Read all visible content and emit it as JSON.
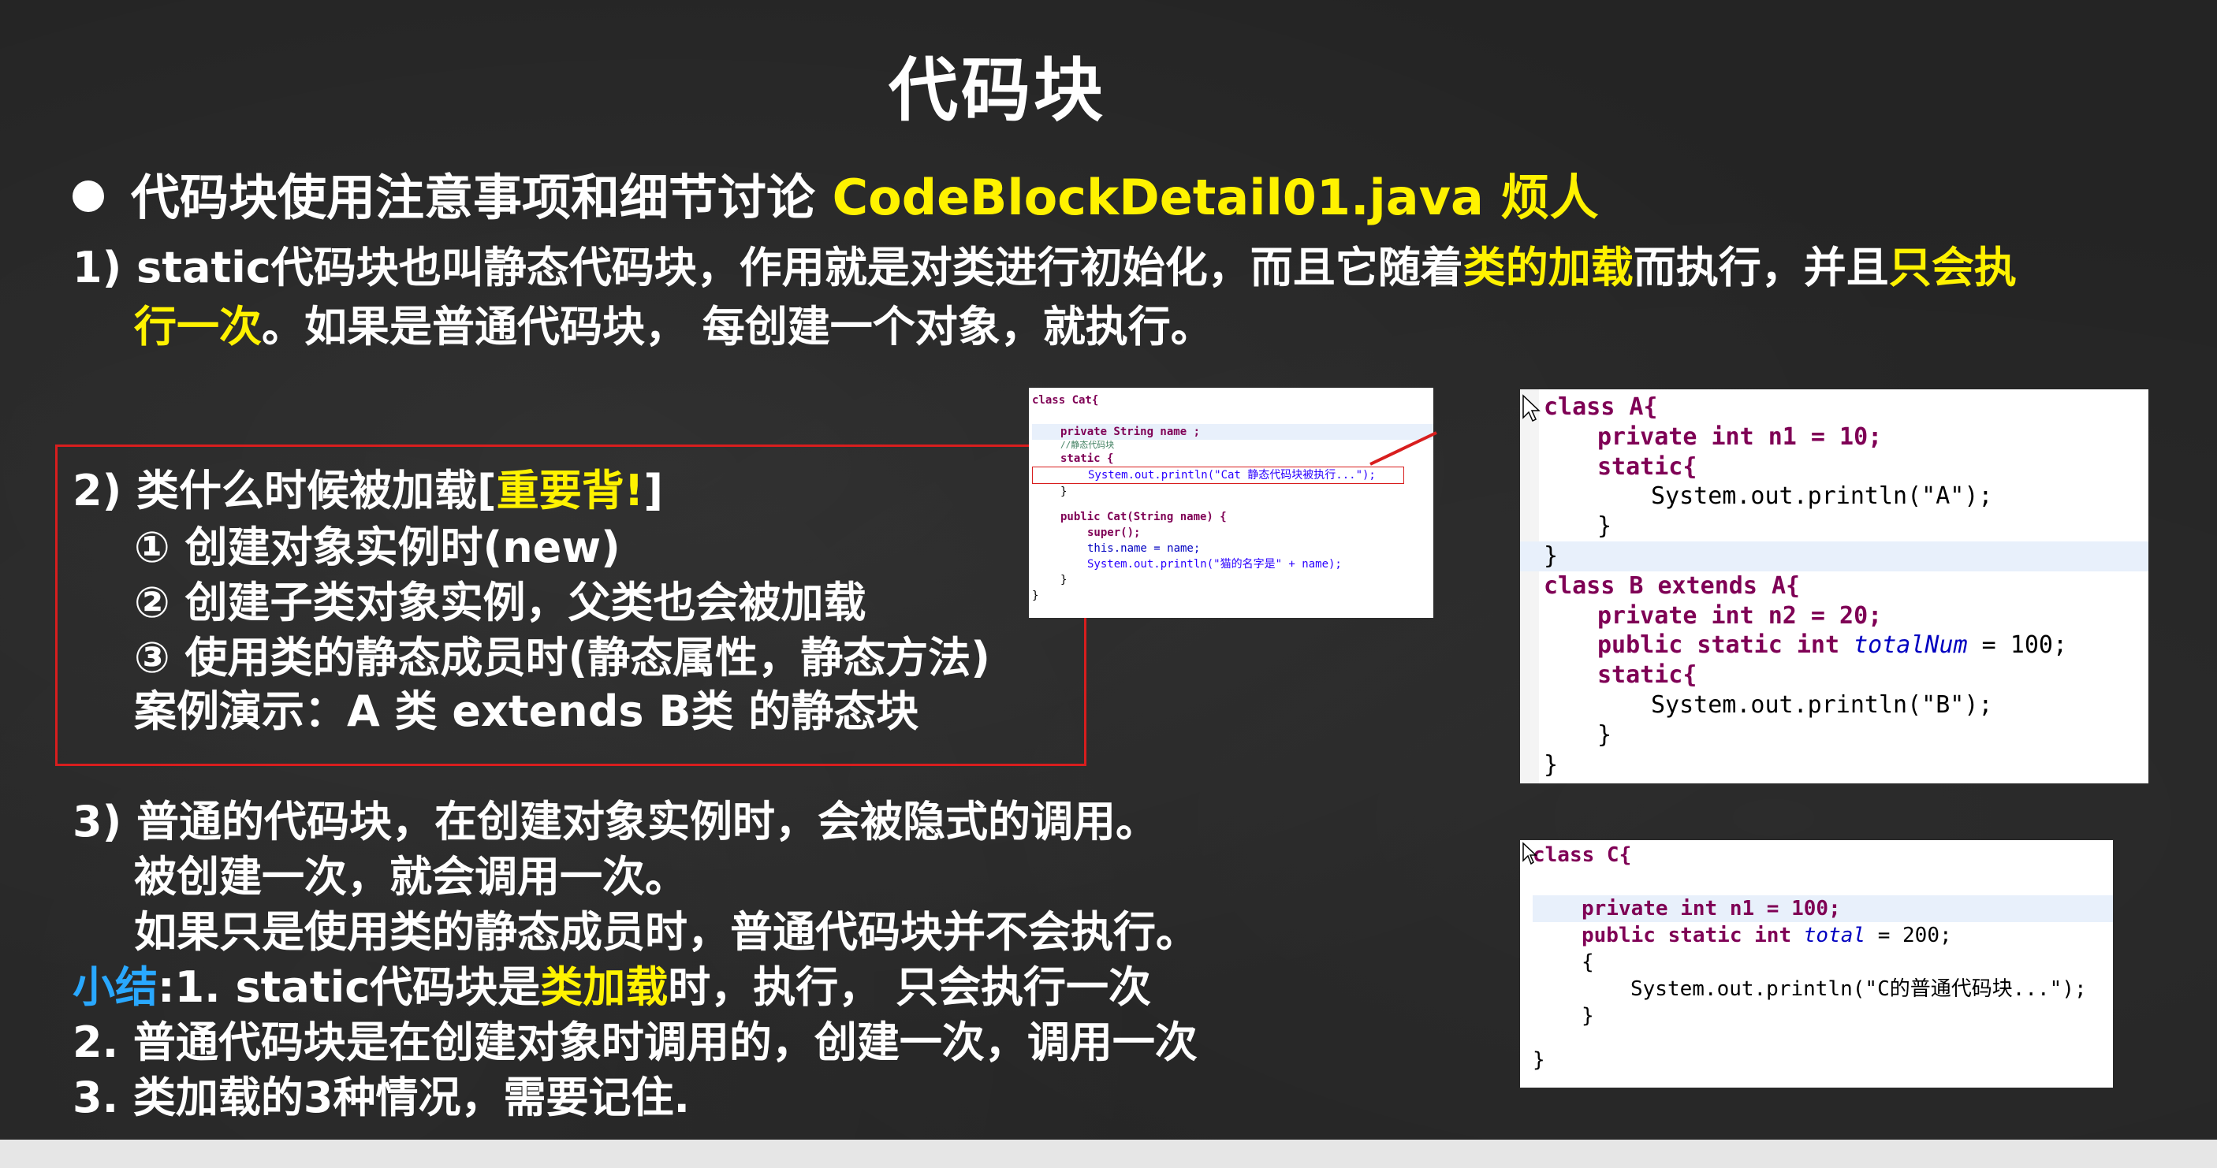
{
  "slide": {
    "title": "代码块",
    "heading": {
      "text": "代码块使用注意事项和细节讨论",
      "highlight": "CodeBlockDetail01.java 烦人"
    },
    "point1": {
      "line1_a": "1) static代码块也叫静态代码块，作用就是对类进行初始化，而且它随着",
      "line1_hl": "类的加载",
      "line1_b": "而执行，并且",
      "line1_hl2": "只会执",
      "line2_hl": "行一次",
      "line2_b": "。如果是普通代码块， 每创建一个对象，就执行。"
    },
    "point2": {
      "title_a": "2) 类什么时候被加载[",
      "title_hl": "重要背!",
      "title_b": "]",
      "item1": "① 创建对象实例时(new)",
      "item2": "② 创建子类对象实例，父类也会被加载",
      "item3": "③ 使用类的静态成员时(静态属性，静态方法)",
      "demo": "案例演示：A 类 extends  B类 的静态块"
    },
    "point3": {
      "line1": "3) 普通的代码块，在创建对象实例时，会被隐式的调用。",
      "line2": "被创建一次，就会调用一次。",
      "line3": "如果只是使用类的静态成员时，普通代码块并不会执行。"
    },
    "summary": {
      "label": "小结",
      "s1_a": ":1. static代码块是",
      "s1_hl": "类加载",
      "s1_b": "时，执行， 只会执行一次",
      "s2": "2. 普通代码块是在创建对象时调用的，创建一次，调用一次",
      "s3": "3. 类加载的3种情况，需要记住."
    }
  },
  "code_cat": {
    "l1": "class Cat{",
    "l2": "private String name ;",
    "l3": "//静态代码块",
    "l4": "static {",
    "l5": "System.out.println(\"Cat 静态代码块被执行...\");",
    "l6": "}",
    "l7": "public Cat(String name) {",
    "l8": "super();",
    "l9": "this.name = name;",
    "l10": "System.out.println(\"猫的名字是\" + name);",
    "l11": "}",
    "l12": "}"
  },
  "code_ab": {
    "l1": "class A{",
    "l2": "private int n1 = 10;",
    "l3": "static{",
    "l4": "System.out.println(\"A\");",
    "l5": "}",
    "l6": "}",
    "l7": "class B extends A{",
    "l8": "private int n2 = 20;",
    "l9_a": "public static int ",
    "l9_f": "totalNum",
    "l9_b": " = 100;",
    "l10": "static{",
    "l11": "System.out.println(\"B\");",
    "l12": "}",
    "l13": "}"
  },
  "code_c": {
    "l1": "class C{",
    "l2": "private int n1 = 100;",
    "l3_a": "public static int ",
    "l3_f": "total",
    "l3_b": " = 200;",
    "l4": "{",
    "l5": "System.out.println(\"C的普通代码块...\");",
    "l6": "}",
    "l7": "}"
  },
  "colors": {
    "background": "#242424",
    "highlight_yellow": "#fff200",
    "summary_blue": "#29a8ff",
    "box_red": "#d81e1e"
  }
}
